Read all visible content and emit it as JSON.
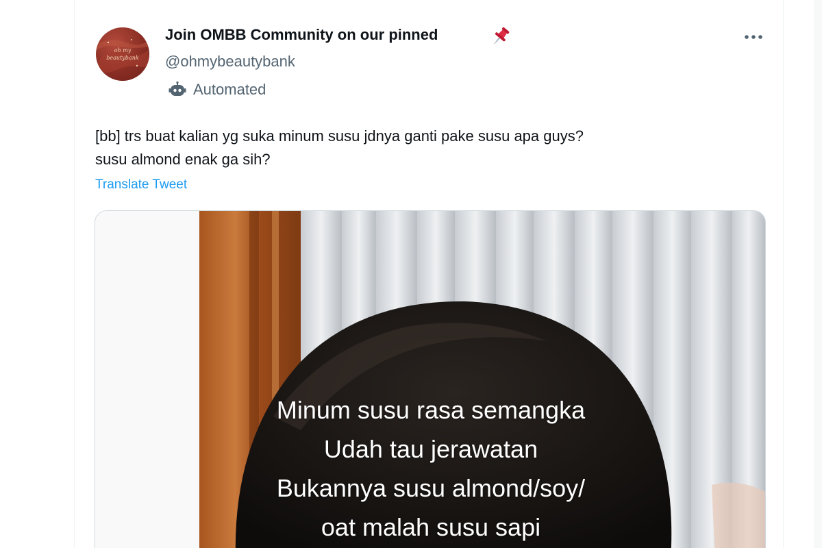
{
  "tweet": {
    "author": {
      "display_name": "Join OMBB Community on our pinned",
      "display_name_emoji": "📌",
      "handle": "@ohmybeautybank",
      "label": "Automated"
    },
    "text_lines": [
      "[bb] trs buat kalian yg suka minum susu jdnya ganti pake susu apa guys?",
      "susu almond enak ga sih?"
    ],
    "translate_label": "Translate Tweet",
    "media": {
      "caption_lines": [
        "Minum susu rasa semangka",
        "Udah tau jerawatan",
        "Bukannya susu almond/soy/",
        "oat malah susu sapi"
      ]
    }
  },
  "icons": {
    "more": "more-horizontal-icon",
    "pin": "pushpin-icon",
    "automated": "robot-icon"
  },
  "colors": {
    "text_primary": "#0f1419",
    "text_secondary": "#536471",
    "link": "#1d9bf0",
    "avatar_bg": "#8a2e24",
    "pin": "#e0245e"
  }
}
